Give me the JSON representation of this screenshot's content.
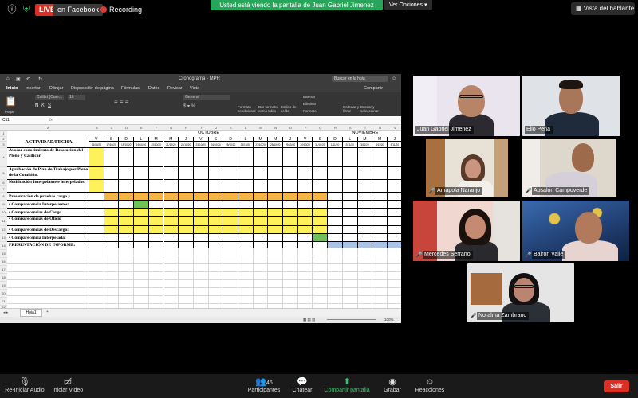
{
  "topbar": {
    "live_label": "LIVE",
    "facebook_label": "en Facebook",
    "recording_label": "Recording",
    "share_banner": "Usted está viendo la pantalla de Juan Gabriel Jimenez",
    "view_options": "Ver Opciones",
    "speaker_view": "Vista del hablante"
  },
  "excel": {
    "window_title": "Cronograma - MPR",
    "search_placeholder": "Buscar en la hoja",
    "share_label": "Compartir",
    "tabs": [
      "Inicio",
      "Insertar",
      "Dibujar",
      "Disposición de página",
      "Fórmulas",
      "Datos",
      "Revisar",
      "Vista"
    ],
    "font_name": "Calibri (Cuer...",
    "font_size": "16",
    "number_format": "General",
    "ribbon_groups": {
      "paste": "Pegar",
      "conditional": "Formato condicional",
      "table": "Dar formato como tabla",
      "cell_styles": "Estilos de celda",
      "insert": "Insertar",
      "delete": "Eliminar",
      "format": "Formato",
      "sort": "Ordenar y filtrar",
      "find": "Buscar y seleccionar"
    },
    "name_box": "C11",
    "fx": "fx",
    "columns": [
      "A",
      "B",
      "C",
      "D",
      "E",
      "F",
      "G",
      "H",
      "I",
      "J",
      "K",
      "L",
      "M",
      "N",
      "O",
      "P",
      "Q",
      "R",
      "S",
      "T",
      "U",
      "V"
    ],
    "month_oct": "OCTUBRE",
    "month_nov": "NOVIEMBRE",
    "header_label": "ACTIVIDAD/FECHA",
    "day_letters": [
      "V",
      "S",
      "D",
      "L",
      "M",
      "M",
      "J",
      "V",
      "S",
      "D",
      "L",
      "M",
      "M",
      "J",
      "V",
      "S",
      "D",
      "L",
      "M",
      "M",
      "J"
    ],
    "dates": [
      "16/10/20",
      "17/10/20",
      "18/10/20",
      "19/10/20",
      "20/10/20",
      "21/10/20",
      "22/10/20",
      "23/10/20",
      "24/10/20",
      "25/10/20",
      "26/10/20",
      "27/10/20",
      "28/10/20",
      "29/10/20",
      "30/10/20",
      "31/10/20",
      "1/11/20",
      "2/11/20",
      "3/11/20",
      "4/11/20",
      "5/11/20"
    ],
    "activities": [
      "Avocar conocimiento de Resolución del Pleno y Calificar.",
      "Aprobación de Plan de Trabajo por Pleno de la Comisión.",
      "Notificación Interpelante e interpelados.",
      "Presentación de pruebas cargo y descargo:",
      "• Comparecencia Interpelantes:",
      "• Comparecencias de Cargo",
      "• Comparecencias de Oficio",
      "• Comparecencias de Descargo:",
      "• Comparecencia Interpelada:",
      "PRESENTACIÓN DE INFORME:"
    ],
    "sheet_tab": "Hoja1",
    "zoom": "100%"
  },
  "participants": [
    {
      "name": "Juan Gabriel Jimenez"
    },
    {
      "name": "Elio Peña"
    },
    {
      "name": "Amapola Naranjo"
    },
    {
      "name": "Absalón Campoverde"
    },
    {
      "name": "Mercedes Serrano"
    },
    {
      "name": "Bairon Valle"
    },
    {
      "name": "Noralma Zambrano"
    }
  ],
  "bottombar": {
    "audio": "Re-Iniciar Audio",
    "video": "Iniciar Video",
    "participants": "Participantes",
    "participants_count": "46",
    "chat": "Chatear",
    "share": "Compartir pantalla",
    "record": "Grabar",
    "reactions": "Reacciones",
    "leave": "Salir"
  },
  "colors": {
    "yellow": "#fff15a",
    "orange": "#f4b548",
    "green": "#6fbf5a",
    "blue": "#a9c4e6",
    "live": "#d93025",
    "banner": "#26a65b"
  }
}
